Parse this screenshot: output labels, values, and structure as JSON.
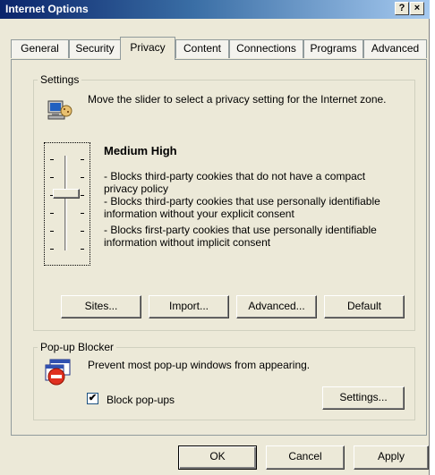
{
  "window": {
    "title": "Internet Options",
    "help_label": "?",
    "close_label": "×"
  },
  "tabs": [
    {
      "label": "General"
    },
    {
      "label": "Security"
    },
    {
      "label": "Privacy"
    },
    {
      "label": "Content"
    },
    {
      "label": "Connections"
    },
    {
      "label": "Programs"
    },
    {
      "label": "Advanced"
    }
  ],
  "active_tab": "Privacy",
  "settings": {
    "legend": "Settings",
    "instruction": "Move the slider to select a privacy setting for the Internet zone.",
    "level_title": "Medium High",
    "slider_level_label": "Medium High",
    "description_lines": [
      "- Blocks third-party cookies that do not have a compact privacy policy",
      "- Blocks third-party cookies that use personally identifiable information without your explicit consent",
      "- Blocks first-party cookies that use personally identifiable information without implicit consent"
    ],
    "buttons": {
      "sites": "Sites...",
      "import": "Import...",
      "advanced": "Advanced...",
      "default": "Default"
    }
  },
  "popup": {
    "legend": "Pop-up Blocker",
    "description": "Prevent most pop-up windows from appearing.",
    "checkbox_label": "Block pop-ups",
    "checkbox_checked": true,
    "settings_button": "Settings..."
  },
  "footer": {
    "ok": "OK",
    "cancel": "Cancel",
    "apply": "Apply"
  },
  "colors": {
    "title_start": "#0a246a",
    "title_end": "#a6caf0",
    "face": "#ece9d8",
    "popup_icon_red": "#e03020"
  }
}
